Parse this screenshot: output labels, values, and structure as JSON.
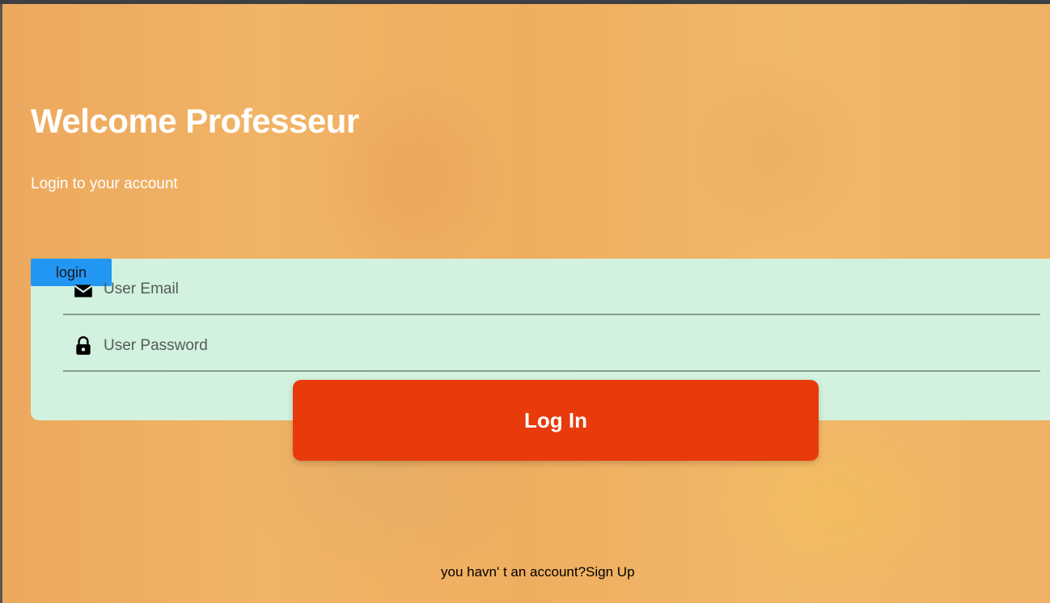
{
  "header": {
    "title": "Welcome Professeur",
    "subtitle": "Login to your account"
  },
  "form": {
    "tag_label": "login",
    "email": {
      "placeholder": "User Email",
      "icon": "mail-icon"
    },
    "password": {
      "placeholder": "User Password",
      "icon": "lock-icon"
    },
    "submit_label": "Log In"
  },
  "footer": {
    "question": "you havn' t an account?",
    "signup_label": "Sign Up"
  },
  "colors": {
    "accent_button": "#e83a0a",
    "tag_blue": "#2196f3",
    "card_bg": "#d0f6e8",
    "overlay_orange": "#f4a846"
  }
}
